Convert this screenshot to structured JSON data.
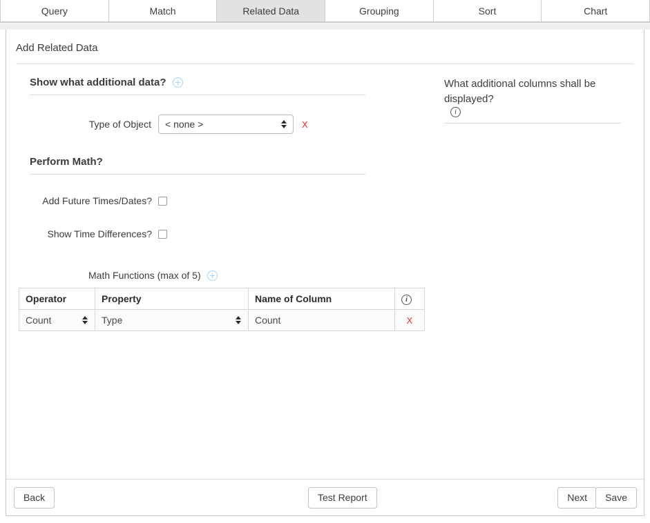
{
  "tabs": [
    {
      "label": "Query",
      "active": false
    },
    {
      "label": "Match",
      "active": false
    },
    {
      "label": "Related Data",
      "active": true
    },
    {
      "label": "Grouping",
      "active": false
    },
    {
      "label": "Sort",
      "active": false
    },
    {
      "label": "Chart",
      "active": false
    }
  ],
  "panel": {
    "title": "Add Related Data"
  },
  "left": {
    "section_additional_data": {
      "heading": "Show what additional data?",
      "add_icon": "plus-circle-icon",
      "type_of_object": {
        "label": "Type of Object",
        "value": "< none >",
        "remove_label": "X"
      }
    },
    "section_math": {
      "heading": "Perform Math?",
      "add_future": {
        "label": "Add Future Times/Dates?",
        "checked": false
      },
      "show_time_diff": {
        "label": "Show Time Differences?",
        "checked": false
      },
      "math_functions": {
        "caption": "Math Functions (max of 5)",
        "add_icon": "plus-circle-icon",
        "columns": [
          "Operator",
          "Property",
          "Name of Column"
        ],
        "info_icon": "info-circle-icon",
        "rows": [
          {
            "operator": "Count",
            "property": "Type",
            "name_of_column": "Count",
            "remove_label": "X"
          }
        ]
      }
    }
  },
  "right": {
    "heading": "What additional columns shall be displayed?",
    "info_icon": "info-circle-icon"
  },
  "footer": {
    "back": "Back",
    "test_report": "Test Report",
    "next": "Next",
    "save": "Save"
  },
  "colors": {
    "accent_blue": "#a8d3ef",
    "danger_red": "#e03030",
    "active_tab_bg": "#e2e2e2",
    "border": "#c6c6c6"
  }
}
